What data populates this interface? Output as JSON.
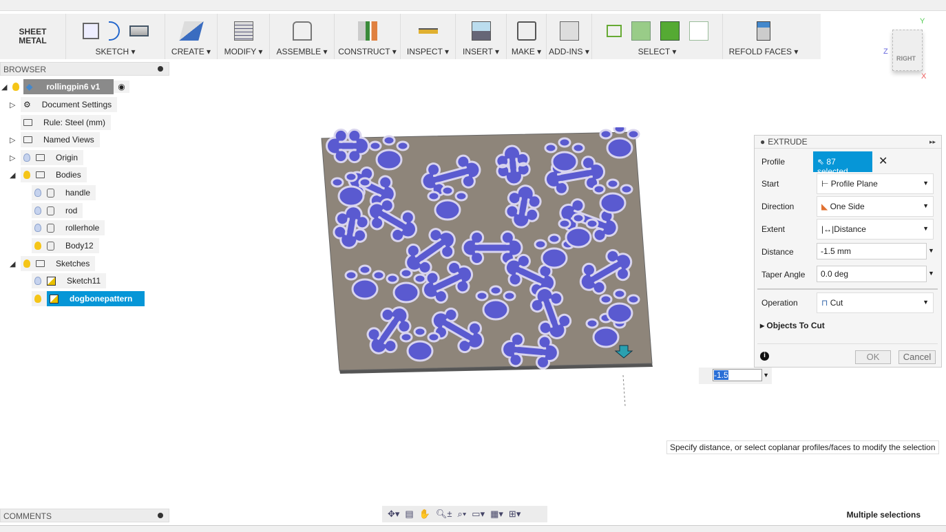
{
  "toolbar": {
    "sheet_metal": "SHEET METAL",
    "groups": [
      "SKETCH",
      "CREATE",
      "MODIFY",
      "ASSEMBLE",
      "CONSTRUCT",
      "INSPECT",
      "INSERT",
      "MAKE",
      "ADD-INS",
      "SELECT",
      "REFOLD FACES"
    ]
  },
  "browser": {
    "title": "BROWSER",
    "items": [
      "rollingpin6 v1",
      "Document Settings",
      "Rule: Steel (mm)",
      "Named Views",
      "Origin",
      "Bodies",
      "handle",
      "rod",
      "rollerhole",
      "Body12",
      "Sketches",
      "Sketch11",
      "dogbonepattern"
    ]
  },
  "comments": {
    "title": "COMMENTS"
  },
  "viewcube": {
    "face": "RIGHT",
    "axes": [
      "Y",
      "Z",
      "X"
    ]
  },
  "extrude": {
    "title": "EXTRUDE",
    "profile_label": "Profile",
    "profile_value": "87 selected",
    "start_label": "Start",
    "start_value": "Profile Plane",
    "direction_label": "Direction",
    "direction_value": "One Side",
    "extent_label": "Extent",
    "extent_value": "Distance",
    "distance_label": "Distance",
    "distance_value": "-1.5 mm",
    "taper_label": "Taper Angle",
    "taper_value": "0.0 deg",
    "operation_label": "Operation",
    "operation_value": "Cut",
    "objects_to_cut": "Objects To Cut",
    "ok": "OK",
    "cancel": "Cancel"
  },
  "distance_input": "-1.5",
  "tooltip": "Specify distance, or select coplanar profiles/faces to modify the selection",
  "status": "Multiple selections",
  "colors": {
    "accent": "#0696d7",
    "plate": "#8e857a",
    "profile": "#5a5ad0"
  }
}
